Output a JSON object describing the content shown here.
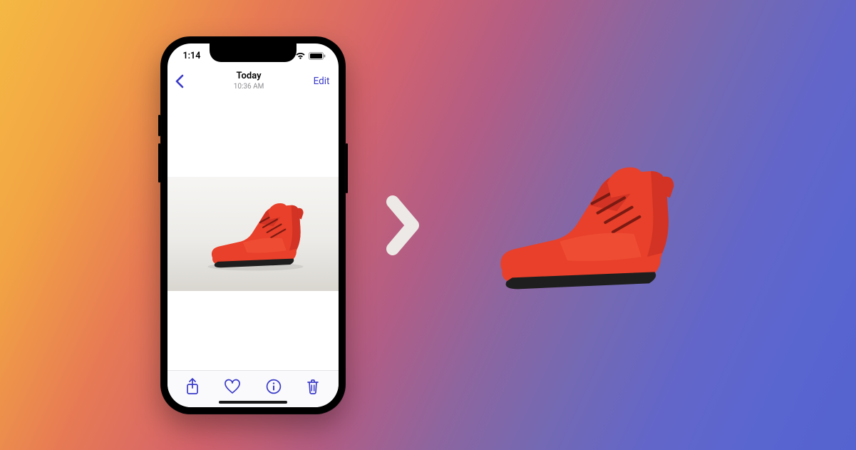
{
  "statusbar": {
    "time": "1:14"
  },
  "nav": {
    "title": "Today",
    "subtitle": "10:36 AM",
    "edit_label": "Edit"
  },
  "colors": {
    "ios_blue": "#3a3ac9",
    "shoe_body": "#e8402a",
    "shoe_dark": "#b32018",
    "shoe_sole": "#1e1e1e"
  }
}
